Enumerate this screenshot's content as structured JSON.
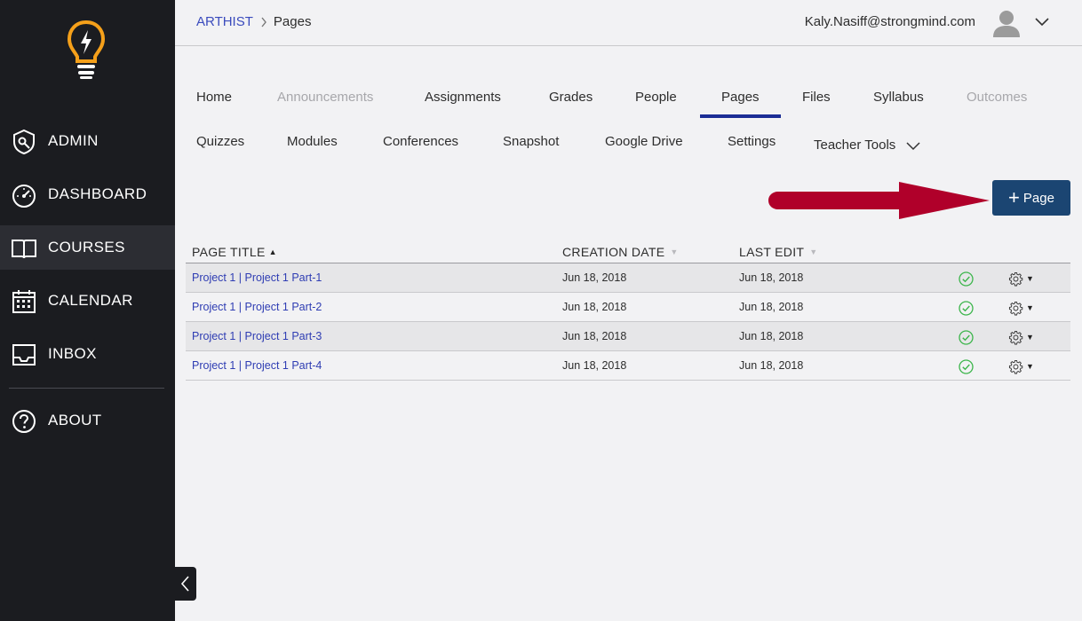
{
  "sidebar": {
    "items": [
      {
        "label": "ADMIN",
        "icon": "admin-shield-icon"
      },
      {
        "label": "DASHBOARD",
        "icon": "speedometer-icon"
      },
      {
        "label": "COURSES",
        "icon": "book-icon",
        "active": true
      },
      {
        "label": "CALENDAR",
        "icon": "calendar-icon"
      },
      {
        "label": "INBOX",
        "icon": "inbox-icon"
      },
      {
        "label": "ABOUT",
        "icon": "question-icon"
      }
    ]
  },
  "header": {
    "breadcrumb": {
      "course": "ARTHIST",
      "separator": ">",
      "current": "Pages"
    },
    "user_email": "Kaly.Nasiff@strongmind.com"
  },
  "tabs": {
    "row1": [
      {
        "label": "Home"
      },
      {
        "label": "Announcements",
        "disabled": true
      },
      {
        "label": "Assignments"
      },
      {
        "label": "Grades"
      },
      {
        "label": "People"
      },
      {
        "label": "Pages",
        "active": true
      },
      {
        "label": "Files"
      },
      {
        "label": "Syllabus"
      },
      {
        "label": "Outcomes",
        "disabled": true
      }
    ],
    "row2": [
      {
        "label": "Quizzes"
      },
      {
        "label": "Modules"
      },
      {
        "label": "Conferences"
      },
      {
        "label": "Snapshot"
      },
      {
        "label": "Google Drive"
      },
      {
        "label": "Settings"
      },
      {
        "label": "Teacher Tools"
      }
    ]
  },
  "actions": {
    "add_page_label": "Page",
    "add_page_symbol": "+"
  },
  "table": {
    "headers": {
      "title": "PAGE TITLE",
      "created": "CREATION DATE",
      "edited": "LAST EDIT",
      "sort_asc": "▲",
      "sort_desc": "▼"
    },
    "rows": [
      {
        "title": "Project 1 | Project 1 Part-1",
        "created": "Jun 18, 2018",
        "edited": "Jun 18, 2018",
        "published": true
      },
      {
        "title": "Project 1 | Project 1 Part-2",
        "created": "Jun 18, 2018",
        "edited": "Jun 18, 2018",
        "published": true
      },
      {
        "title": "Project 1 | Project 1 Part-3",
        "created": "Jun 18, 2018",
        "edited": "Jun 18, 2018",
        "published": true
      },
      {
        "title": "Project 1 | Project 1 Part-4",
        "created": "Jun 18, 2018",
        "edited": "Jun 18, 2018",
        "published": true
      }
    ],
    "row_menu_caret": "▼"
  },
  "colors": {
    "sidebar_bg": "#1b1c20",
    "logo_orange": "#f5a01a",
    "link_blue": "#2f3db3",
    "active_tab": "#1b2d95",
    "button_navy": "#1b4572",
    "annotation_arrow": "#b0002a",
    "published_green": "#3bb54a"
  }
}
